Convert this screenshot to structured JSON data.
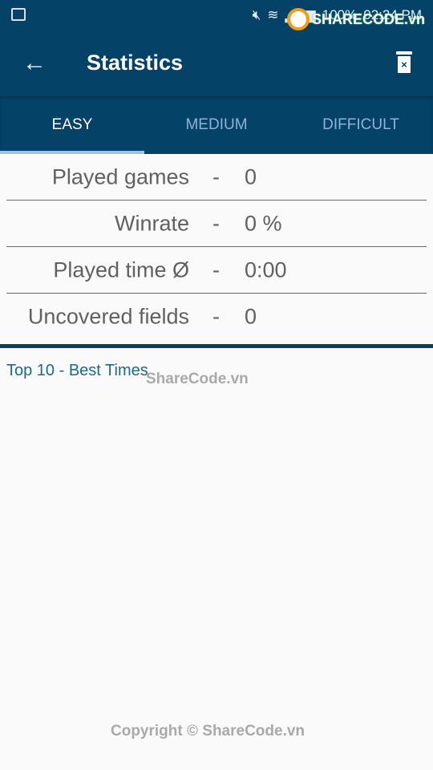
{
  "status_bar": {
    "battery": "100%",
    "time": "02:24 PM"
  },
  "watermark": {
    "logo_text": "SHARECODE.vn",
    "center_text": "ShareCode.vn",
    "copyright": "Copyright © ShareCode.vn"
  },
  "toolbar": {
    "title": "Statistics",
    "back_icon": "arrow-left-icon",
    "delete_icon": "trash-x-icon"
  },
  "tabs": [
    {
      "label": "EASY",
      "active": true
    },
    {
      "label": "MEDIUM"
    },
    {
      "label": "DIFFICULT"
    }
  ],
  "stats": [
    {
      "label": "Played games",
      "sep": "-",
      "value": "0"
    },
    {
      "label": "Winrate",
      "sep": "-",
      "value": "0 %"
    },
    {
      "label": "Played time Ø",
      "sep": "-",
      "value": "0:00"
    },
    {
      "label": "Uncovered fields",
      "sep": "-",
      "value": "0"
    }
  ],
  "top10": {
    "heading": "Top 10 - Best Times"
  },
  "colors": {
    "primary": "#044268",
    "accent": "#1b6a8c",
    "text": "#616161"
  }
}
